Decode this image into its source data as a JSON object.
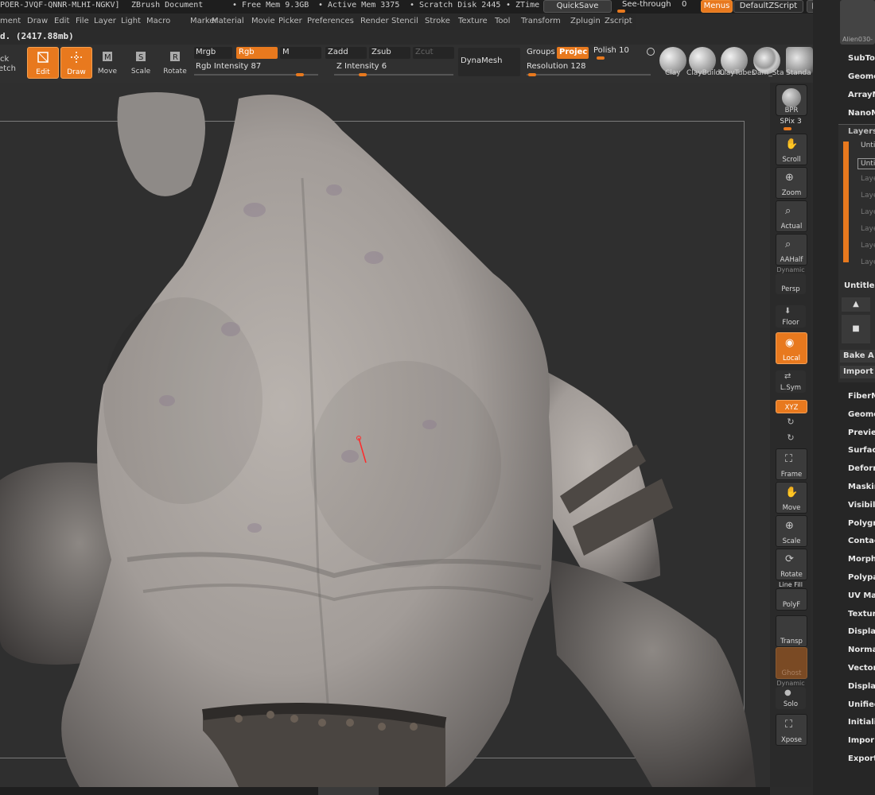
{
  "topbar": {
    "id_text": "POER-JVQF-QNNR-MLHI-NGKV]",
    "doc_title": "ZBrush Document",
    "free_mem": "• Free Mem 9.3GB",
    "active_mem": "• Active Mem 3375",
    "scratch": "• Scratch Disk 2445",
    "ztime": "• ZTime",
    "quicksave": "QuickSave",
    "seethrough": "See-through",
    "seethrough_val": "0",
    "menus": "Menus",
    "script": "DefaultZScript"
  },
  "menubar": [
    "ment",
    "Draw",
    "Edit",
    "File",
    "Layer",
    "Light",
    "Macro",
    "Marker",
    "Material",
    "Movie",
    "Picker",
    "Preferences",
    "Render",
    "Stencil",
    "Stroke",
    "Texture",
    "Tool",
    "Transform",
    "Zplugin",
    "Zscript"
  ],
  "status": "d. (2417.88mb)",
  "toolbar": {
    "sketch_top": "ck",
    "sketch_bottom": "etch",
    "edit": "Edit",
    "draw": "Draw",
    "move": "Move",
    "scale": "Scale",
    "rotate": "Rotate",
    "mrgb": "Mrgb",
    "rgb": "Rgb",
    "m": "M",
    "zadd": "Zadd",
    "zsub": "Zsub",
    "zcut": "Zcut",
    "rgb_intensity": "Rgb  Intensity 87",
    "z_intensity": "Z  Intensity 6",
    "dynamesh": "DynaMesh",
    "groups": "Groups",
    "project": "Projec",
    "polish": "Polish 10",
    "resolution": "Resolution 128",
    "rgb_intensity_value": 0.87,
    "z_intensity_value": 0.06,
    "brushes": [
      "Clay",
      "ClayBuildu",
      "ClayTubes",
      "Dam_Sta",
      "Standa"
    ]
  },
  "shelf": {
    "bpr": "BPR",
    "spix": "SPix 3",
    "scroll": "Scroll",
    "zoom": "Zoom",
    "actual": "Actual",
    "aahalf": "AAHalf",
    "dynamic": "Dynamic",
    "persp": "Persp",
    "floor": "Floor",
    "local": "Local",
    "lsym": "L.Sym",
    "xyz": "XYZ",
    "frame": "Frame",
    "move": "Move",
    "scale": "Scale",
    "rotate": "Rotate",
    "linefill": "Line Fill",
    "polyf": "PolyF",
    "transp": "Transp",
    "ghost": "Ghost",
    "dynamic2": "Dynamic",
    "solo": "Solo",
    "xpose": "Xpose"
  },
  "rpanel": {
    "thumb_label": "Alien030-",
    "items": [
      "SubTool",
      "Geome",
      "ArrayM",
      "NanoM"
    ],
    "layers_title": "Layers",
    "layer_rows": [
      "Untit",
      "Untit",
      "Laye",
      "Laye",
      "Laye",
      "Laye",
      "Laye",
      "Laye"
    ],
    "untitled": "Untitled",
    "bake": "Bake A",
    "import1": "Import",
    "items2": [
      "FiberM",
      "Geome",
      "Previe",
      "Surfac",
      "Deform",
      "Maskin",
      "Visibili",
      "Polygr",
      "Contac",
      "Morph",
      "Polypa",
      "UV Map",
      "Textur",
      "Displa",
      "Norma",
      "Vector",
      "Display",
      "Unified",
      "Initiali",
      "Impor",
      "Export"
    ]
  },
  "colors": {
    "accent": "#e8791e",
    "bg": "#2f2f2f"
  }
}
